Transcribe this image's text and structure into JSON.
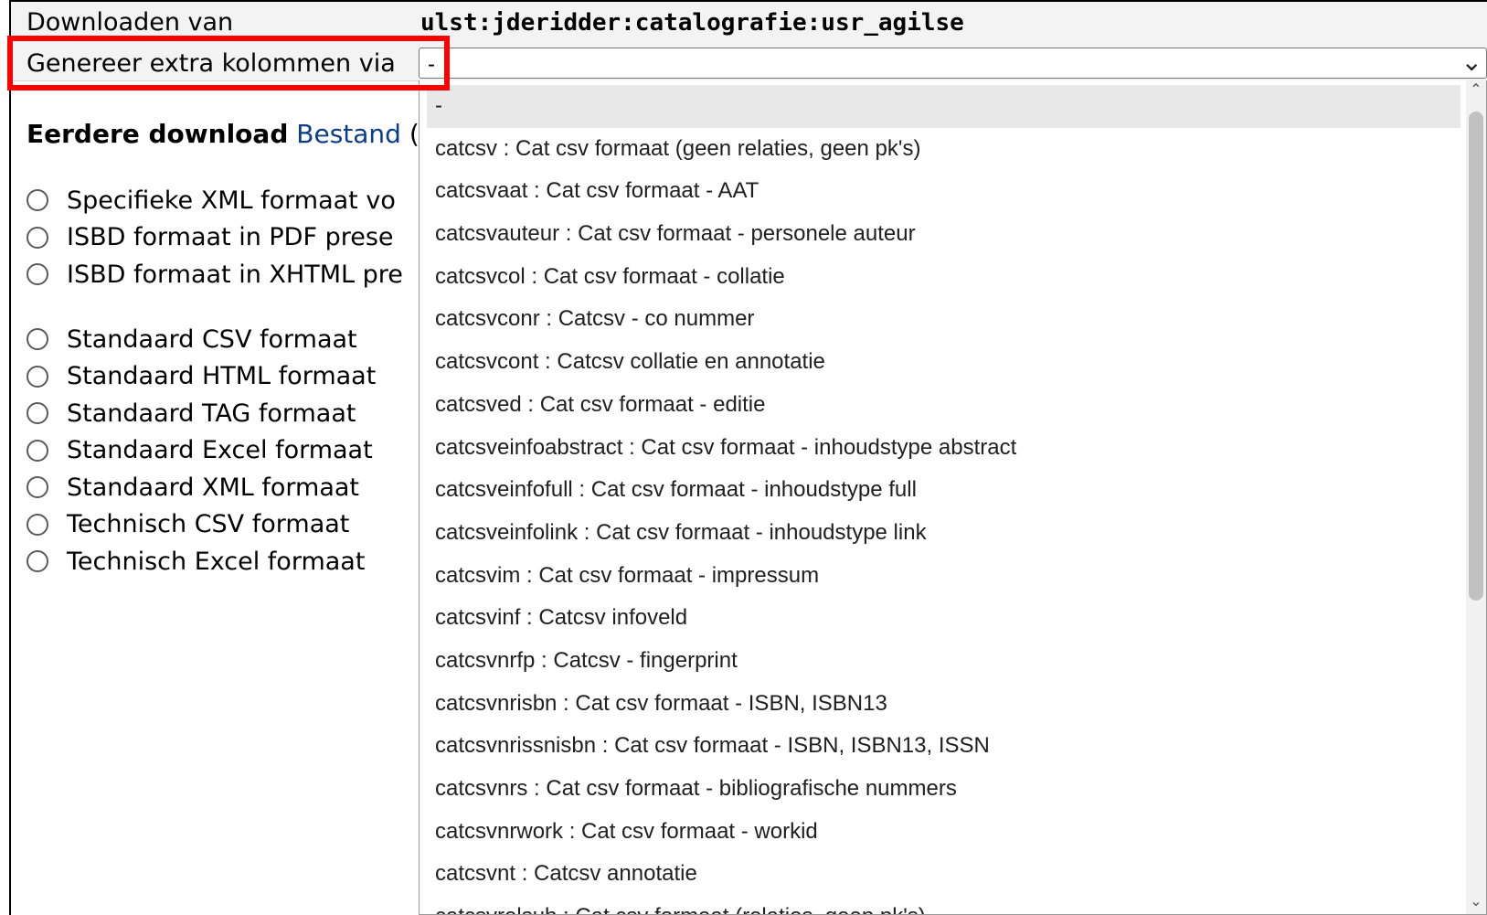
{
  "header": {
    "download_label": "Downloaden van",
    "download_value": "ulst:jderidder:catalografie:usr_agilse",
    "generate_label": "Genereer extra kolommen via",
    "select_value": "-"
  },
  "earlier": {
    "label": "Eerdere download",
    "link": "Bestand",
    "paren": "("
  },
  "formats_group1": [
    "Specifieke XML formaat vo",
    "ISBD formaat in PDF prese",
    "ISBD formaat in XHTML pre"
  ],
  "formats_group2": [
    "Standaard CSV formaat",
    "Standaard HTML formaat",
    "Standaard TAG formaat",
    "Standaard Excel formaat",
    "Standaard XML formaat",
    "Technisch CSV formaat",
    "Technisch Excel formaat"
  ],
  "dropdown": {
    "options": [
      "-",
      "catcsv : Cat csv formaat (geen relaties, geen pk's)",
      "catcsvaat : Cat csv formaat - AAT",
      "catcsvauteur : Cat csv formaat - personele auteur",
      "catcsvcol : Cat csv formaat - collatie",
      "catcsvconr : Catcsv - co nummer",
      "catcsvcont : Catcsv collatie en annotatie",
      "catcsved : Cat csv formaat - editie",
      "catcsveinfoabstract : Cat csv formaat - inhoudstype abstract",
      "catcsveinfofull : Cat csv formaat - inhoudstype full",
      "catcsveinfolink : Cat csv formaat - inhoudstype link",
      "catcsvim : Cat csv formaat - impressum",
      "catcsvinf : Catcsv infoveld",
      "catcsvnrfp : Catcsv - fingerprint",
      "catcsvnrisbn : Cat csv formaat - ISBN, ISBN13",
      "catcsvnrissnisbn : Cat csv formaat - ISBN, ISBN13, ISSN",
      "catcsvnrs : Cat csv formaat - bibliografische nummers",
      "catcsvnrwork : Cat csv formaat - workid",
      "catcsvnt : Catcsv annotatie",
      "catcsvrelsub : Cat csv formaat (relaties, geen pk's)"
    ]
  },
  "icons": {
    "select_arrow": "chevron-down-icon",
    "scroll_up": "scroll-up-icon",
    "scroll_down": "scroll-down-icon"
  }
}
